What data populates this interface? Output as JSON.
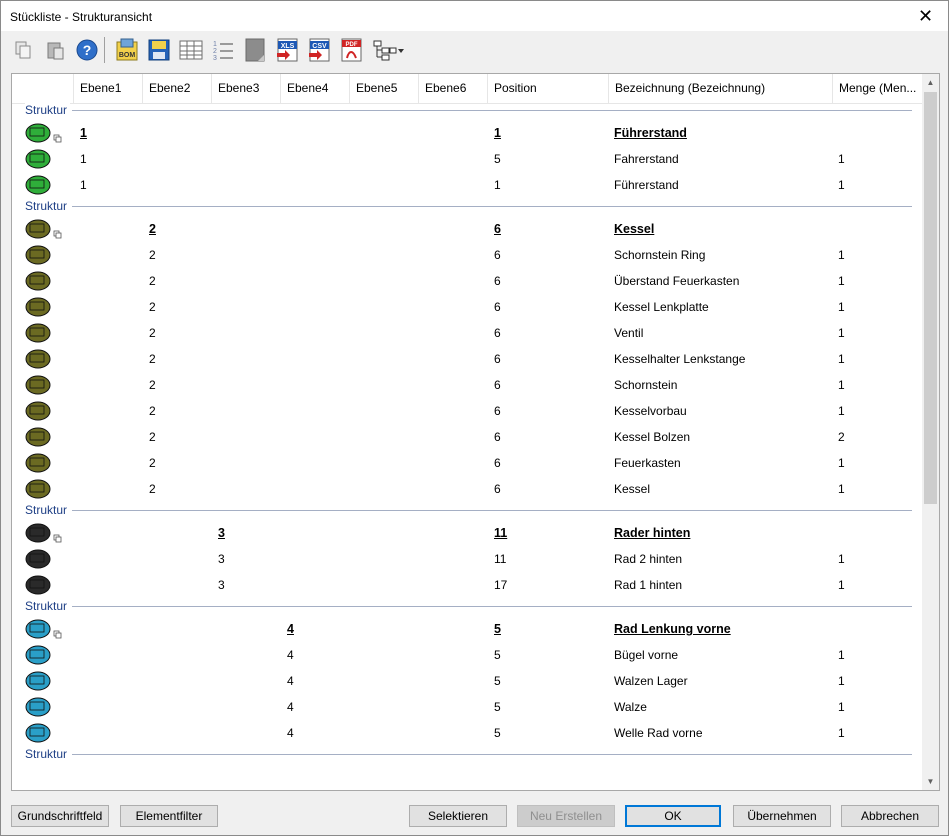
{
  "window": {
    "title": "Stückliste - Strukturansicht"
  },
  "toolbar": {
    "items": [
      "copy-icon",
      "paste-icon",
      "help-icon",
      "bom-icon",
      "bom-save-icon",
      "table-icon",
      "numbered-list-icon",
      "page-icon",
      "xls-export-icon",
      "csv-export-icon",
      "pdf-export-icon",
      "structure-tree-icon"
    ],
    "xls_label": "XLS",
    "csv_label": "CSV",
    "pdf_label": "PDF",
    "bom_label": "BOM"
  },
  "columns": {
    "ebene1": "Ebene1",
    "ebene2": "Ebene2",
    "ebene3": "Ebene3",
    "ebene4": "Ebene4",
    "ebene5": "Ebene5",
    "ebene6": "Ebene6",
    "position": "Position",
    "bezeichnung": "Bezeichnung (Bezeichnung)",
    "menge": "Menge (Men..."
  },
  "group_label": "Struktur",
  "groups": [
    {
      "label": "Struktur",
      "header": {
        "ebene": "1",
        "position": "1",
        "bezeichnung": "Führerstand"
      },
      "rows": [
        {
          "ebene": "1",
          "position": "5",
          "bezeichnung": "Fahrerstand",
          "menge": "1"
        },
        {
          "ebene": "1",
          "position": "1",
          "bezeichnung": "Führerstand",
          "menge": "1"
        }
      ]
    },
    {
      "label": "Struktur",
      "header": {
        "ebene": "2",
        "position": "6",
        "bezeichnung": "Kessel"
      },
      "rows": [
        {
          "ebene": "2",
          "position": "6",
          "bezeichnung": "Schornstein Ring",
          "menge": "1"
        },
        {
          "ebene": "2",
          "position": "6",
          "bezeichnung": "Überstand Feuerkasten",
          "menge": "1"
        },
        {
          "ebene": "2",
          "position": "6",
          "bezeichnung": "Kessel Lenkplatte",
          "menge": "1"
        },
        {
          "ebene": "2",
          "position": "6",
          "bezeichnung": "Ventil",
          "menge": "1"
        },
        {
          "ebene": "2",
          "position": "6",
          "bezeichnung": "Kesselhalter Lenkstange",
          "menge": "1"
        },
        {
          "ebene": "2",
          "position": "6",
          "bezeichnung": "Schornstein",
          "menge": "1"
        },
        {
          "ebene": "2",
          "position": "6",
          "bezeichnung": "Kesselvorbau",
          "menge": "1"
        },
        {
          "ebene": "2",
          "position": "6",
          "bezeichnung": "Kessel Bolzen",
          "menge": "2"
        },
        {
          "ebene": "2",
          "position": "6",
          "bezeichnung": "Feuerkasten",
          "menge": "1"
        },
        {
          "ebene": "2",
          "position": "6",
          "bezeichnung": "Kessel",
          "menge": "1"
        }
      ]
    },
    {
      "label": "Struktur",
      "header": {
        "ebene": "3",
        "position": "11",
        "bezeichnung": "Rader hinten"
      },
      "rows": [
        {
          "ebene": "3",
          "position": "11",
          "bezeichnung": "Rad 2 hinten",
          "menge": "1"
        },
        {
          "ebene": "3",
          "position": "17",
          "bezeichnung": "Rad 1 hinten",
          "menge": "1"
        }
      ]
    },
    {
      "label": "Struktur",
      "header": {
        "ebene": "4",
        "position": "5",
        "bezeichnung": "Rad Lenkung vorne"
      },
      "rows": [
        {
          "ebene": "4",
          "position": "5",
          "bezeichnung": "Bügel vorne",
          "menge": "1"
        },
        {
          "ebene": "4",
          "position": "5",
          "bezeichnung": "Walzen Lager",
          "menge": "1"
        },
        {
          "ebene": "4",
          "position": "5",
          "bezeichnung": "Walze",
          "menge": "1"
        },
        {
          "ebene": "4",
          "position": "5",
          "bezeichnung": "Welle Rad vorne",
          "menge": "1"
        }
      ]
    },
    {
      "label": "Struktur",
      "header": null,
      "rows": []
    }
  ],
  "buttons": {
    "grundschriftfeld": "Grundschriftfeld",
    "elementfilter": "Elementfilter",
    "selektieren": "Selektieren",
    "neu_erstellen": "Neu Erstellen",
    "ok": "OK",
    "uebernehmen": "Übernehmen",
    "abbrechen": "Abbrechen"
  }
}
